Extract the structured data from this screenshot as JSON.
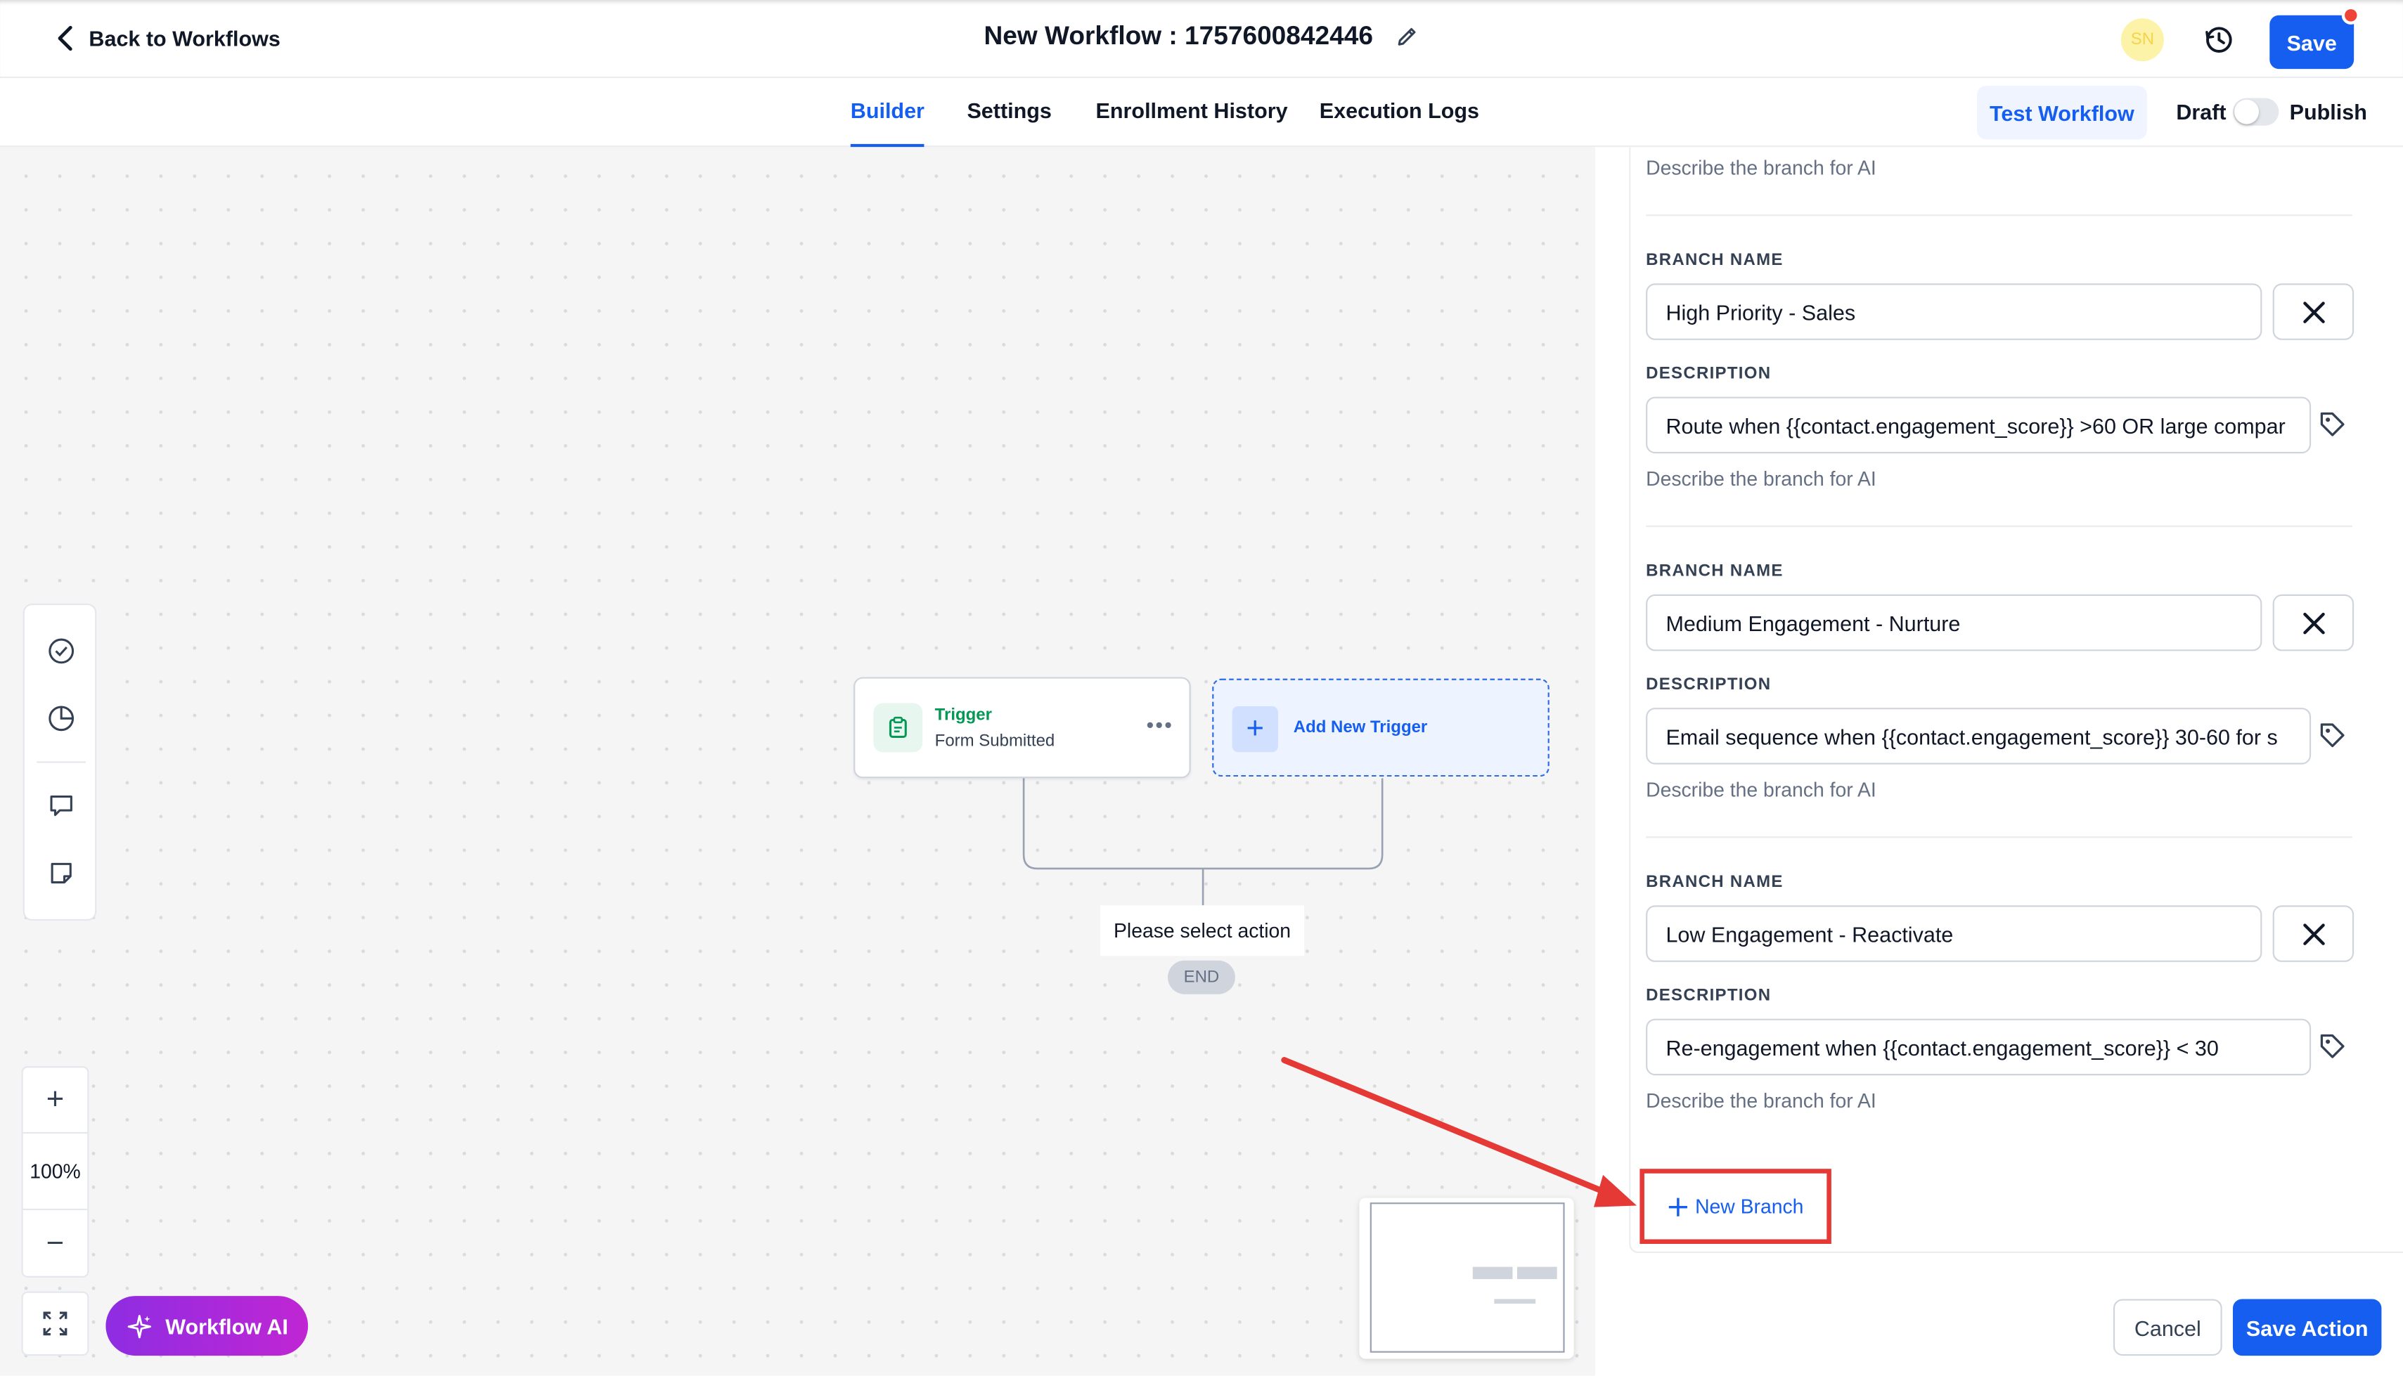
{
  "header": {
    "back_label": "Back to Workflows",
    "title": "New Workflow : 1757600842446",
    "avatar_initials": "SN",
    "save_label": "Save"
  },
  "tabs": [
    {
      "label": "Builder",
      "active": true
    },
    {
      "label": "Settings",
      "active": false
    },
    {
      "label": "Enrollment History",
      "active": false
    },
    {
      "label": "Execution Logs",
      "active": false
    }
  ],
  "toolbar": {
    "test_label": "Test Workflow",
    "draft_label": "Draft",
    "publish_label": "Publish",
    "publish_enabled": false
  },
  "canvas": {
    "trigger_title": "Trigger",
    "trigger_subtitle": "Form Submitted",
    "add_trigger_label": "Add New Trigger",
    "select_action_label": "Please select action",
    "end_label": "END",
    "zoom_level": "100%",
    "workflow_ai_label": "Workflow AI"
  },
  "panel": {
    "top_hint": "Describe the branch for AI",
    "branch_name_label": "BRANCH NAME",
    "description_label": "DESCRIPTION",
    "description_hint": "Describe the branch for AI",
    "branches": [
      {
        "name": "High Priority - Sales",
        "description": "Route when {{contact.engagement_score}} >60 OR large compar"
      },
      {
        "name": "Medium Engagement - Nurture",
        "description": "Email sequence when  {{contact.engagement_score}} 30-60 for s"
      },
      {
        "name": "Low Engagement - Reactivate",
        "description": "Re-engagement when {{contact.engagement_score}} < 30"
      }
    ],
    "new_branch_label": "New Branch",
    "cancel_label": "Cancel",
    "save_action_label": "Save Action"
  },
  "colors": {
    "accent": "#155eef",
    "highlight": "#e53935",
    "trigger_green": "#039855"
  }
}
